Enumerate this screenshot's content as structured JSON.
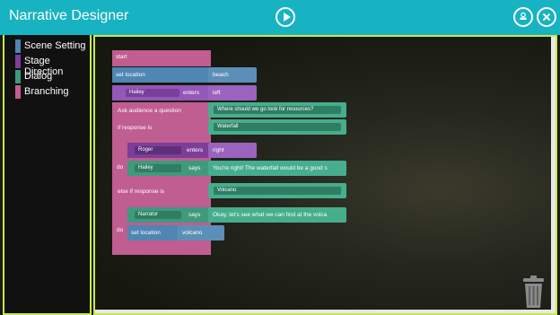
{
  "app": {
    "title": "Narrative Designer"
  },
  "toolbar": {
    "play_icon": "play-icon",
    "save_icon": "save-icon",
    "close_icon": "close-icon"
  },
  "categories": [
    {
      "label": "Scene Setting",
      "color": "#4f86b3"
    },
    {
      "label": "Stage Direction",
      "color": "#7d3e9a"
    },
    {
      "label": "Dialog",
      "color": "#3f9a7c"
    },
    {
      "label": "Branching",
      "color": "#c05d91"
    }
  ],
  "blocks": {
    "start": "start",
    "set_location": "set location",
    "location_value": "beach",
    "hailey_char": "Hailey",
    "enters": "enters",
    "enters_side": "left",
    "ask_audience": "Ask audience a question",
    "question_text": "Where should we go look for resources?",
    "if_response": "if response is",
    "if_value": "Waterfall",
    "do_label_1": "do",
    "roger_char": "Roger",
    "roger_enters": "enters",
    "roger_side": "right",
    "hailey_says_char": "Hailey",
    "says_1": "says",
    "hailey_line": "You're right! The waterfall would be a good s",
    "else_if": "else if response is",
    "else_value": "Volcano",
    "do_label_2": "do",
    "narrator_char": "Narrator",
    "says_2": "says",
    "narrator_line": "Okay, let's see what we can find at the volca",
    "set_location_2": "set location",
    "location_value_2": "volcano"
  },
  "colors": {
    "topbar": "#17b3c2",
    "accent_border": "#c8e84f",
    "branching": "#c05d91",
    "scene": "#4f86b3",
    "stage": "#7d3e9a",
    "dialog": "#3f9a7c"
  }
}
